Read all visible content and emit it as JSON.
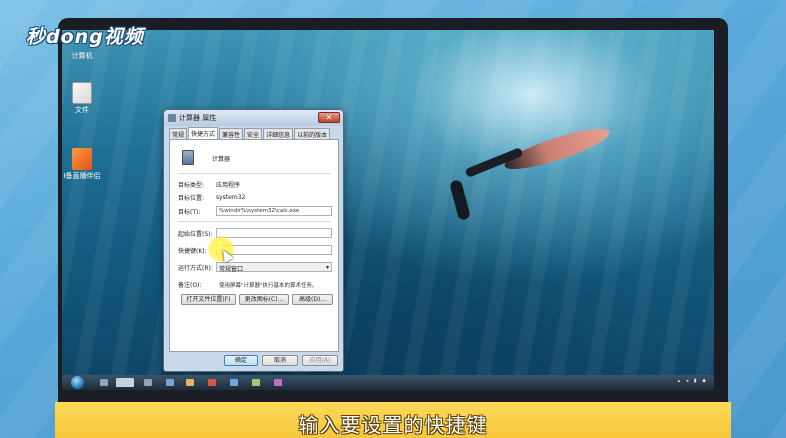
{
  "brand": {
    "text": "秒dong视频"
  },
  "desktop": {
    "icons": [
      {
        "label": "计算机"
      },
      {
        "label": "文件"
      },
      {
        "label": "I备直播伴侣"
      }
    ]
  },
  "dialog": {
    "title": "计算器 属性",
    "close_label": "✕",
    "tabs": [
      "常规",
      "快捷方式",
      "兼容性",
      "安全",
      "详细信息",
      "以前的版本"
    ],
    "active_tab": "快捷方式",
    "app_name": "计算器",
    "fields": {
      "target_type": {
        "label": "目标类型:",
        "value": "应用程序"
      },
      "target_location": {
        "label": "目标位置:",
        "value": "system32"
      },
      "target": {
        "label": "目标(T):",
        "value": "%windir%\\system32\\calc.exe"
      },
      "start_in": {
        "label": "起始位置(S):",
        "value": ""
      },
      "shortcut_key": {
        "label": "快捷键(K):",
        "value": "无"
      },
      "run": {
        "label": "运行方式(R):",
        "value": "常规窗口"
      },
      "comment": {
        "label": "备注(O):",
        "value": "使用屏幕\"计算器\"执行基本的算术任务。"
      }
    },
    "buttons": {
      "open_location": "打开文件位置(F)",
      "change_icon": "更改图标(C)...",
      "advanced": "高级(D)...",
      "ok": "确定",
      "cancel": "取消",
      "apply": "应用(A)"
    }
  },
  "caption": {
    "text": "输入要设置的快捷键"
  }
}
